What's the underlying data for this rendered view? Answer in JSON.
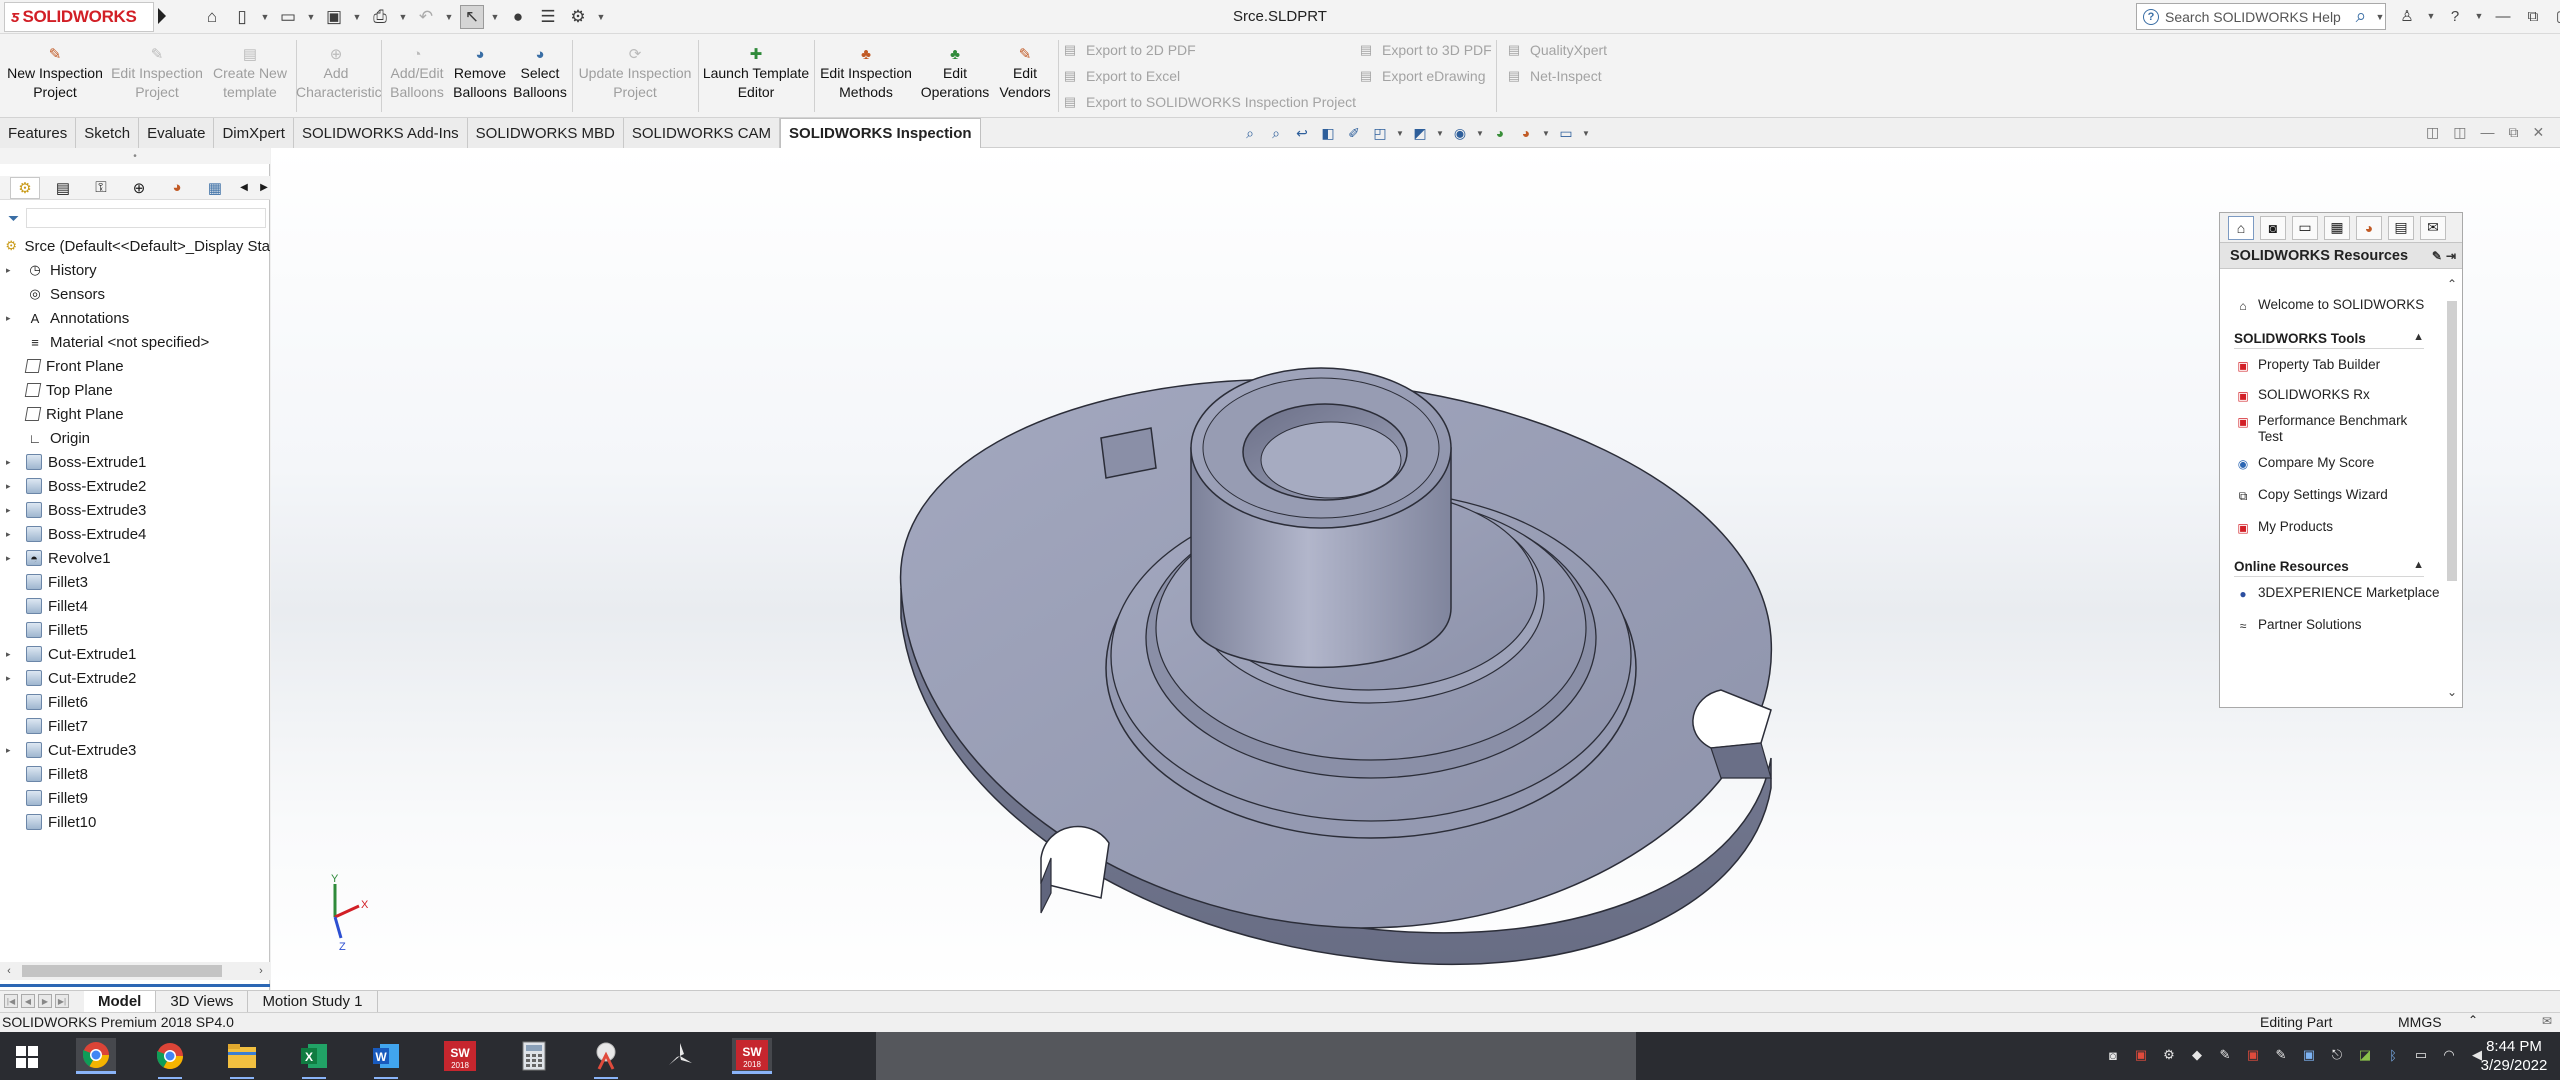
{
  "app": {
    "logo_text": "SOLIDWORKS",
    "document_title": "Srce.SLDPRT"
  },
  "search": {
    "placeholder": "Search SOLIDWORKS Help"
  },
  "command_manager": {
    "buttons": [
      {
        "line1": "New Inspection",
        "line2": "Project",
        "enabled": true
      },
      {
        "line1": "Edit Inspection",
        "line2": "Project",
        "enabled": false
      },
      {
        "line1": "Create New",
        "line2": "template",
        "enabled": false
      },
      {
        "line1": "Add",
        "line2": "Characteristic",
        "enabled": false
      },
      {
        "line1": "Add/Edit",
        "line2": "Balloons",
        "enabled": false
      },
      {
        "line1": "Remove",
        "line2": "Balloons",
        "enabled": true
      },
      {
        "line1": "Select",
        "line2": "Balloons",
        "enabled": true
      },
      {
        "line1": "Update Inspection",
        "line2": "Project",
        "enabled": false
      },
      {
        "line1": "Launch Template",
        "line2": "Editor",
        "enabled": true
      },
      {
        "line1": "Edit Inspection",
        "line2": "Methods",
        "enabled": true
      },
      {
        "line1": "Edit",
        "line2": "Operations",
        "enabled": true
      },
      {
        "line1": "Edit",
        "line2": "Vendors",
        "enabled": true
      }
    ],
    "export_items": {
      "pdf2d": "Export to 2D PDF",
      "excel": "Export to Excel",
      "project": "Export to SOLIDWORKS Inspection Project",
      "pdf3d": "Export to 3D PDF",
      "edrawing": "Export eDrawing",
      "qualityxpert": "QualityXpert",
      "netinspect": "Net-Inspect"
    }
  },
  "tabs": [
    "Features",
    "Sketch",
    "Evaluate",
    "DimXpert",
    "SOLIDWORKS Add-Ins",
    "SOLIDWORKS MBD",
    "SOLIDWORKS CAM",
    "SOLIDWORKS Inspection"
  ],
  "active_tab": "SOLIDWORKS Inspection",
  "feature_tree": {
    "root": "Srce  (Default<<Default>_Display Sta",
    "items": [
      {
        "label": "History",
        "expand": true,
        "icon": "history-icon"
      },
      {
        "label": "Sensors",
        "expand": false,
        "icon": "sensors-icon"
      },
      {
        "label": "Annotations",
        "expand": true,
        "icon": "annotations-icon"
      },
      {
        "label": "Material <not specified>",
        "expand": false,
        "icon": "material-icon"
      },
      {
        "label": "Front Plane",
        "expand": false,
        "icon": "plane-icon"
      },
      {
        "label": "Top Plane",
        "expand": false,
        "icon": "plane-icon"
      },
      {
        "label": "Right Plane",
        "expand": false,
        "icon": "plane-icon"
      },
      {
        "label": "Origin",
        "expand": false,
        "icon": "origin-icon"
      },
      {
        "label": "Boss-Extrude1",
        "expand": true,
        "icon": "extrude-icon"
      },
      {
        "label": "Boss-Extrude2",
        "expand": true,
        "icon": "extrude-icon"
      },
      {
        "label": "Boss-Extrude3",
        "expand": true,
        "icon": "extrude-icon"
      },
      {
        "label": "Boss-Extrude4",
        "expand": true,
        "icon": "extrude-icon"
      },
      {
        "label": "Revolve1",
        "expand": true,
        "icon": "revolve-icon"
      },
      {
        "label": "Fillet3",
        "expand": false,
        "icon": "fillet-icon"
      },
      {
        "label": "Fillet4",
        "expand": false,
        "icon": "fillet-icon"
      },
      {
        "label": "Fillet5",
        "expand": false,
        "icon": "fillet-icon"
      },
      {
        "label": "Cut-Extrude1",
        "expand": true,
        "icon": "cut-extrude-icon"
      },
      {
        "label": "Cut-Extrude2",
        "expand": true,
        "icon": "cut-extrude-icon"
      },
      {
        "label": "Fillet6",
        "expand": false,
        "icon": "fillet-icon"
      },
      {
        "label": "Fillet7",
        "expand": false,
        "icon": "fillet-icon"
      },
      {
        "label": "Cut-Extrude3",
        "expand": true,
        "icon": "cut-extrude-icon"
      },
      {
        "label": "Fillet8",
        "expand": false,
        "icon": "fillet-icon"
      },
      {
        "label": "Fillet9",
        "expand": false,
        "icon": "fillet-icon"
      },
      {
        "label": "Fillet10",
        "expand": false,
        "icon": "fillet-icon"
      }
    ]
  },
  "triad": {
    "x": "X",
    "y": "Y",
    "z": "Z"
  },
  "resources": {
    "title": "SOLIDWORKS Resources",
    "welcome": "Welcome to SOLIDWORKS",
    "tools_header": "SOLIDWORKS Tools",
    "tools": [
      "Property Tab Builder",
      "SOLIDWORKS Rx",
      "Performance Benchmark",
      "Test",
      "Compare My Score",
      "Copy Settings Wizard",
      "My Products"
    ],
    "online_header": "Online Resources",
    "online": [
      "3DEXPERIENCE Marketplace",
      "Partner Solutions"
    ]
  },
  "bottom_tabs": [
    "Model",
    "3D Views",
    "Motion Study 1"
  ],
  "active_bottom_tab": "Model",
  "status": {
    "left": "SOLIDWORKS Premium 2018 SP4.0",
    "editing": "Editing Part",
    "units": "MMGS"
  },
  "taskbar": {
    "time": "8:44 PM",
    "date": "3/29/2022",
    "apps": [
      "chrome-icon",
      "chrome-icon",
      "file-explorer-icon",
      "excel-icon",
      "word-icon",
      "solidworks-2018-icon",
      "calculator-icon",
      "snipping-icon",
      "pinwheel-icon",
      "solidworks-2018-icon"
    ],
    "sw_badge": "2018"
  },
  "colors": {
    "brand_red": "#d21f26",
    "part_face": "#8e93ab",
    "selection_blue": "#2c67b4"
  }
}
